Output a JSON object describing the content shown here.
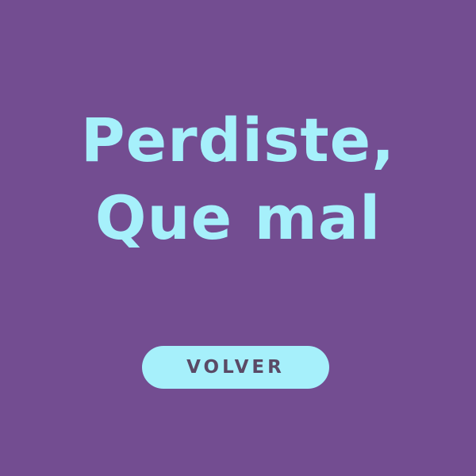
{
  "screen": {
    "message_line1": "Perdiste,",
    "message_line2": "Que mal",
    "back_label": "VOLVER"
  },
  "colors": {
    "background": "#734d91",
    "accent": "#a6f0fb",
    "button_text": "#5a4a66"
  }
}
